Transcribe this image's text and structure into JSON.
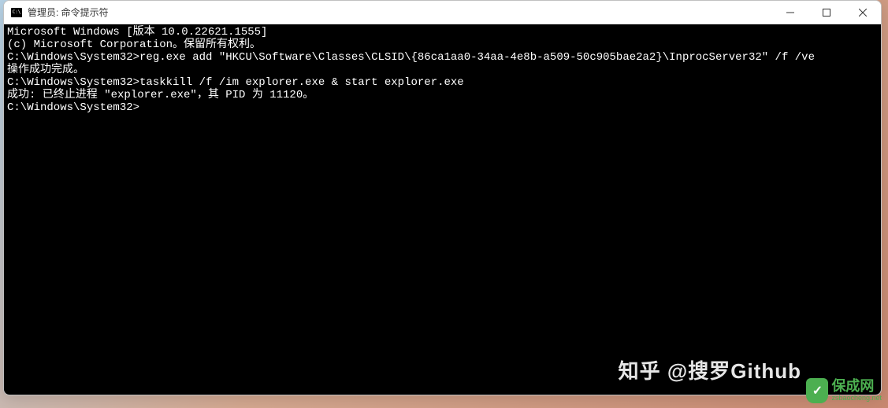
{
  "window": {
    "title": "管理员: 命令提示符"
  },
  "terminal": {
    "lines": [
      "Microsoft Windows [版本 10.0.22621.1555]",
      "(c) Microsoft Corporation。保留所有权利。",
      "",
      "C:\\Windows\\System32>reg.exe add \"HKCU\\Software\\Classes\\CLSID\\{86ca1aa0-34aa-4e8b-a509-50c905bae2a2}\\InprocServer32\" /f /ve",
      "操作成功完成。",
      "",
      "C:\\Windows\\System32>taskkill /f /im explorer.exe & start explorer.exe",
      "成功: 已终止进程 \"explorer.exe\"，其 PID 为 11120。",
      "",
      "C:\\Windows\\System32>"
    ]
  },
  "watermarks": {
    "zhihu": "知乎 @搜罗Github",
    "baocheng_main": "保成网",
    "baocheng_sub": "zsbaocheng.net"
  }
}
